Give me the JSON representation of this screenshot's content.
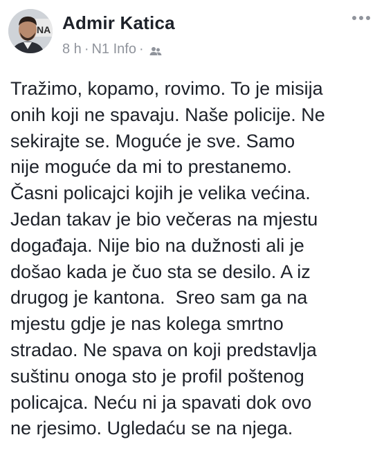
{
  "post": {
    "author": "Admir Katica",
    "time": "8 h",
    "source": "N1 Info",
    "dot": "·",
    "privacy_icon": "friends-icon",
    "more_icon": "more-options-icon",
    "avatar_text": "NA",
    "body_lines": [
      "Tražimo, kopamo, rovimo. To je misija",
      "onih koji ne spavaju. Naše policije. Ne",
      "sekirajte se. Moguće je sve. Samo",
      "nije moguće da mi to prestanemo.",
      "Časni policajci kojih je velika većina.",
      "Jedan takav je bio večeras na mjestu",
      "događaja. Nije bio na dužnosti ali je",
      "došao kada je čuo sta se desilo. A iz",
      "drugog je kantona.  Sreo sam ga na",
      "mjestu gdje je nas kolega smrtno",
      "stradao. Ne spava on koji predstavlja",
      "suštinu onoga sto je profil poštenog",
      "policajca. Neću ni ja spavati dok ovo",
      "ne rjesimo. Ugledaću se na njega."
    ]
  },
  "colors": {
    "text": "#1d2129",
    "meta": "#90949c",
    "background": "#ffffff"
  }
}
